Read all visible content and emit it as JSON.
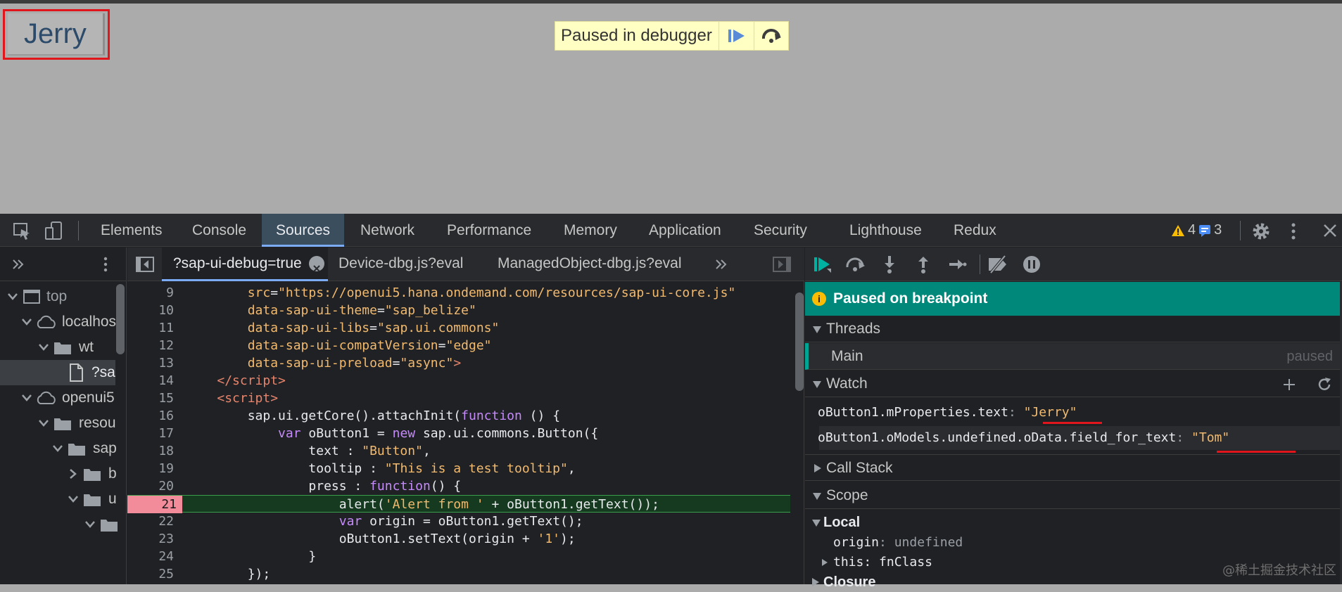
{
  "page": {
    "button_label": "Jerry",
    "paused_banner": "Paused in debugger"
  },
  "devtools_tabs": [
    "Elements",
    "Console",
    "Sources",
    "Network",
    "Performance",
    "Memory",
    "Application",
    "Security",
    "Lighthouse",
    "Redux"
  ],
  "issues": {
    "warnings": "4",
    "messages": "3"
  },
  "file_tree": {
    "top": "top",
    "localhost": "localhos",
    "wt": "wt",
    "file": "?sa",
    "openui5": "openui5",
    "resources": "resou",
    "sap": "sap",
    "b": "b",
    "u": "u"
  },
  "editor_tabs": [
    "?sap-ui-debug=true",
    "Device-dbg.js?eval",
    "ManagedObject-dbg.js?eval"
  ],
  "code_lines": [
    {
      "n": "9",
      "indent": "    ",
      "html": "<span class=\"a\">src</span><span class=\"v\">=</span><span class=\"s\">\"https://openui5.hana.ondemand.com/resources/sap-ui-core.js\"</span>"
    },
    {
      "n": "10",
      "indent": "    ",
      "html": "<span class=\"a\">data-sap-ui-theme</span><span class=\"v\">=</span><span class=\"s\">\"sap_belize\"</span>"
    },
    {
      "n": "11",
      "indent": "    ",
      "html": "<span class=\"a\">data-sap-ui-libs</span><span class=\"v\">=</span><span class=\"s\">\"sap.ui.commons\"</span>"
    },
    {
      "n": "12",
      "indent": "    ",
      "html": "<span class=\"a\">data-sap-ui-compatVersion</span><span class=\"v\">=</span><span class=\"s\">\"edge\"</span>"
    },
    {
      "n": "13",
      "indent": "    ",
      "html": "<span class=\"a\">data-sap-ui-preload</span><span class=\"v\">=</span><span class=\"s\">\"async\"</span><span class=\"t\">&gt;</span>"
    },
    {
      "n": "14",
      "indent": "",
      "html": "<span class=\"t\">&lt;/script&gt;</span>"
    },
    {
      "n": "15",
      "indent": "",
      "html": "<span class=\"t\">&lt;script&gt;</span>"
    },
    {
      "n": "16",
      "indent": "    ",
      "html": "sap.ui.getCore().attachInit(<span class=\"k\">function</span> () {"
    },
    {
      "n": "17",
      "indent": "        ",
      "html": "<span class=\"k\">var</span> oButton1 = <span class=\"k\">new</span> sap.ui.commons.Button({"
    },
    {
      "n": "18",
      "indent": "            ",
      "html": "text : <span class=\"s\">\"Button\"</span>,"
    },
    {
      "n": "19",
      "indent": "            ",
      "html": "tooltip : <span class=\"s\">\"This is a test tooltip\"</span>,"
    },
    {
      "n": "20",
      "indent": "            ",
      "html": "press : <span class=\"k\">function</span>() {"
    },
    {
      "n": "21",
      "indent": "                ",
      "html": "alert(<span class=\"s\">'Alert from '</span> + oButton1.getText());",
      "bp": true
    },
    {
      "n": "22",
      "indent": "                ",
      "html": "<span class=\"k\">var</span> origin = oButton1.getText();"
    },
    {
      "n": "23",
      "indent": "                ",
      "html": "oButton1.setText(origin + <span class=\"s\">'1'</span>);"
    },
    {
      "n": "24",
      "indent": "            ",
      "html": "}"
    },
    {
      "n": "25",
      "indent": "    ",
      "html": "});"
    }
  ],
  "debugger": {
    "status": "Paused on breakpoint",
    "threads_label": "Threads",
    "thread_name": "Main",
    "thread_state": "paused",
    "watch_label": "Watch",
    "watch": [
      {
        "expr": "oButton1.mProperties.text",
        "value": "\"Jerry\""
      },
      {
        "expr": "oButton1.oModels.undefined.oData.field_for_text",
        "value": "\"Tom\""
      }
    ],
    "call_stack_label": "Call Stack",
    "scope_label": "Scope",
    "local_label": "Local",
    "scope_vars": [
      {
        "name": "origin",
        "value": "undefined"
      },
      {
        "name": "this",
        "value": "fnClass"
      }
    ],
    "closure_label": "Closure"
  },
  "watermark": "@稀土掘金技术社区"
}
